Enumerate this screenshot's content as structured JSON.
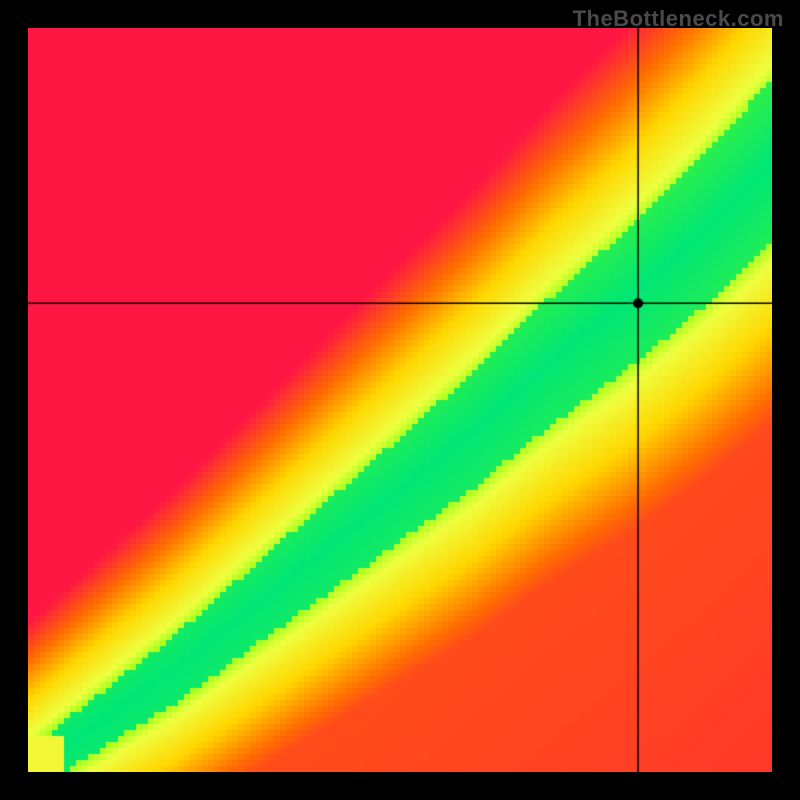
{
  "watermark": "TheBottleneck.com",
  "chart_data": {
    "type": "heatmap",
    "title": "",
    "xlabel": "",
    "ylabel": "",
    "xlim": [
      0,
      100
    ],
    "ylim": [
      0,
      100
    ],
    "crosshair": {
      "x": 82,
      "y": 63
    },
    "marker": {
      "x": 82,
      "y": 63
    },
    "ridge": {
      "description": "optimal green ridge where y ≈ f(x) along a slightly super-linear diagonal from origin",
      "points": [
        {
          "x": 0,
          "y": 0
        },
        {
          "x": 10,
          "y": 7
        },
        {
          "x": 20,
          "y": 14
        },
        {
          "x": 30,
          "y": 22
        },
        {
          "x": 40,
          "y": 30
        },
        {
          "x": 50,
          "y": 38
        },
        {
          "x": 60,
          "y": 46
        },
        {
          "x": 70,
          "y": 55
        },
        {
          "x": 80,
          "y": 63
        },
        {
          "x": 90,
          "y": 72
        },
        {
          "x": 100,
          "y": 82
        }
      ]
    },
    "color_stops": [
      {
        "value": 0.0,
        "color": "#ff1744"
      },
      {
        "value": 0.25,
        "color": "#ff6d00"
      },
      {
        "value": 0.5,
        "color": "#ffd600"
      },
      {
        "value": 0.75,
        "color": "#eeff41"
      },
      {
        "value": 0.9,
        "color": "#76ff03"
      },
      {
        "value": 1.0,
        "color": "#00e676"
      }
    ]
  }
}
